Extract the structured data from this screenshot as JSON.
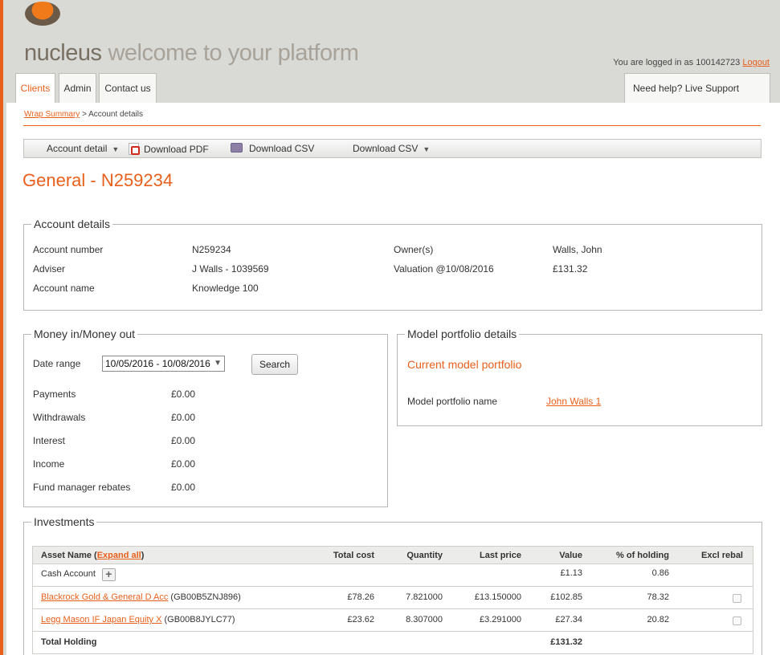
{
  "header": {
    "brand_name": "nucleus",
    "brand_tagline": "welcome to your platform",
    "login_text": "You are logged in as 100142723",
    "logout_label": "Logout"
  },
  "tabs": [
    {
      "label": "Clients",
      "active": true
    },
    {
      "label": "Admin",
      "active": false
    },
    {
      "label": "Contact us",
      "active": false
    }
  ],
  "help": {
    "label": "Need help? Live Support"
  },
  "breadcrumb": {
    "link": "Wrap Summary",
    "separator": ">",
    "current": "Account details"
  },
  "toolbar": {
    "account_detail": "Account detail",
    "download_pdf": "Download PDF",
    "download_csv_1": "Download CSV",
    "download_csv_2": "Download CSV"
  },
  "page_title": "General - N259234",
  "account_details": {
    "legend": "Account details",
    "fields": [
      {
        "label": "Account number",
        "value": "N259234"
      },
      {
        "label": "Adviser",
        "value": "J Walls - 1039569"
      },
      {
        "label": "Account name",
        "value": "Knowledge 100"
      },
      {
        "label": "Owner(s)",
        "value": "Walls, John"
      },
      {
        "label": "Valuation @10/08/2016",
        "value": "£131.32"
      }
    ]
  },
  "money": {
    "legend": "Money in/Money out",
    "date_range_label": "Date range",
    "date_range_value": "10/05/2016 - 10/08/2016",
    "search_label": "Search",
    "rows": [
      {
        "label": "Payments",
        "value": "£0.00"
      },
      {
        "label": "Withdrawals",
        "value": "£0.00"
      },
      {
        "label": "Interest",
        "value": "£0.00"
      },
      {
        "label": "Income",
        "value": "£0.00"
      },
      {
        "label": "Fund manager rebates",
        "value": "£0.00"
      }
    ]
  },
  "model": {
    "legend": "Model portfolio details",
    "current_heading": "Current model portfolio",
    "name_label": "Model portfolio name",
    "name_value": "John Walls 1"
  },
  "investments": {
    "legend": "Investments",
    "headers": {
      "asset_name": "Asset Name (",
      "expand_all": "Expand all",
      "asset_close": ")",
      "total_cost": "Total cost",
      "quantity": "Quantity",
      "last_price": "Last price",
      "value": "Value",
      "pct_holding": "% of holding",
      "excl_rebal": "Excl rebal"
    },
    "cash": {
      "name": "Cash Account",
      "value": "£1.13",
      "pct": "0.86"
    },
    "rows": [
      {
        "name": "Blackrock Gold & General D Acc",
        "code": "(GB00B5ZNJ896)",
        "total_cost": "£78.26",
        "quantity": "7.821000",
        "last_price": "£13.150000",
        "value": "£102.85",
        "pct": "78.32",
        "excl_rebal": false
      },
      {
        "name": "Legg Mason IF Japan Equity X",
        "code": "(GB00B8JYLC77)",
        "total_cost": "£23.62",
        "quantity": "8.307000",
        "last_price": "£3.291000",
        "value": "£27.34",
        "pct": "20.82",
        "excl_rebal": false
      }
    ],
    "total": {
      "label": "Total Holding",
      "value": "£131.32"
    }
  }
}
